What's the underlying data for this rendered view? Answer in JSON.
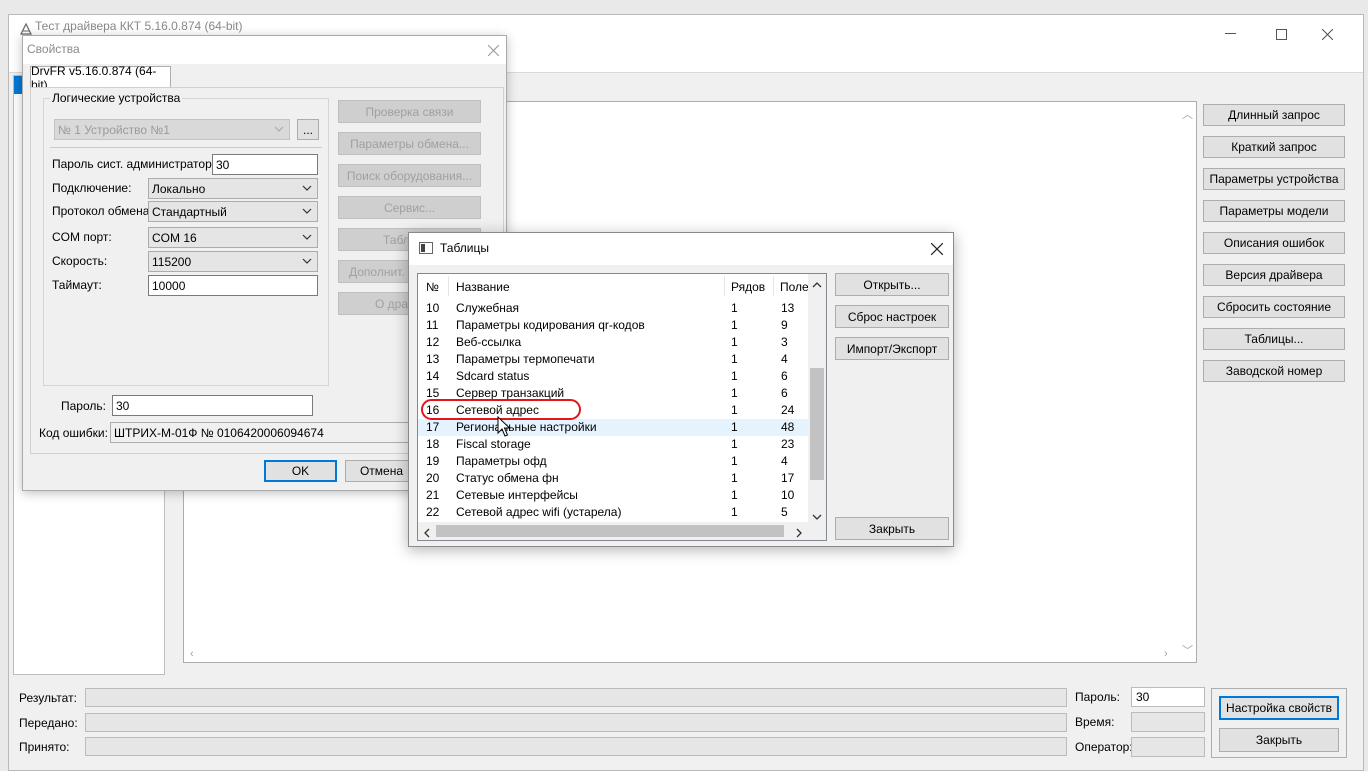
{
  "main_window": {
    "title": "Тест драйвера ККТ 5.16.0.874 (64-bit)",
    "controls": {
      "minimize": "—",
      "maximize": "☐",
      "close": "✕"
    },
    "right_buttons": [
      "Длинный запрос",
      "Краткий запрос",
      "Параметры устройства",
      "Параметры модели",
      "Описания ошибок",
      "Версия драйвера",
      "Сбросить состояние",
      "Таблицы...",
      "Заводской номер"
    ],
    "status": {
      "result_label": "Результат:",
      "sent_label": "Передано:",
      "received_label": "Принято:",
      "password_label": "Пароль:",
      "password_value": "30",
      "time_label": "Время:",
      "operator_label": "Оператор:"
    },
    "settings_button": "Настройка свойств",
    "close_button": "Закрыть"
  },
  "properties": {
    "title": "Свойства",
    "tab": "DrvFR v5.16.0.874 (64-bit)",
    "logical_devices_label": "Логические устройства",
    "logical_device_value": "№ 1 Устройство №1",
    "browse_button": "...",
    "admin_password_label": "Пароль сист. администратора:",
    "admin_password_value": "30",
    "connection_label": "Подключение:",
    "connection_value": "Локально",
    "protocol_label": "Протокол обмена:",
    "protocol_value": "Стандартный",
    "com_label": "COM порт:",
    "com_value": "COM 16",
    "speed_label": "Скорость:",
    "speed_value": "115200",
    "timeout_label": "Таймаут:",
    "timeout_value": "10000",
    "password_label": "Пароль:",
    "password_value": "30",
    "error_label": "Код ошибки:",
    "error_value": "ШТРИХ-М-01Ф № 0106420006094674",
    "side_buttons": [
      "Проверка связи",
      "Параметры обмена...",
      "Поиск оборудования...",
      "Сервис...",
      "Таблицы",
      "Дополнит. па",
      "О драйв"
    ],
    "ok_button": "OK",
    "cancel_button": "Отмена"
  },
  "tables": {
    "title": "Таблицы",
    "columns": {
      "num": "№",
      "name": "Название",
      "rows": "Рядов",
      "fields": "Поле"
    },
    "rows": [
      {
        "num": "10",
        "name": "Служебная",
        "rows": "1",
        "fields": "13"
      },
      {
        "num": "11",
        "name": "Параметры кодирования qr-кодов",
        "rows": "1",
        "fields": "9"
      },
      {
        "num": "12",
        "name": "Веб-ссылка",
        "rows": "1",
        "fields": "3"
      },
      {
        "num": "13",
        "name": "Параметры термопечати",
        "rows": "1",
        "fields": "4"
      },
      {
        "num": "14",
        "name": "Sdcard status",
        "rows": "1",
        "fields": "6"
      },
      {
        "num": "15",
        "name": "Сервер транзакций",
        "rows": "1",
        "fields": "6"
      },
      {
        "num": "16",
        "name": "Сетевой адрес",
        "rows": "1",
        "fields": "24"
      },
      {
        "num": "17",
        "name": "Региональные настройки",
        "rows": "1",
        "fields": "48"
      },
      {
        "num": "18",
        "name": "Fiscal storage",
        "rows": "1",
        "fields": "23"
      },
      {
        "num": "19",
        "name": "Параметры офд",
        "rows": "1",
        "fields": "4"
      },
      {
        "num": "20",
        "name": "Статус обмена фн",
        "rows": "1",
        "fields": "17"
      },
      {
        "num": "21",
        "name": "Сетевые интерфейсы",
        "rows": "1",
        "fields": "10"
      },
      {
        "num": "22",
        "name": "Сетевой адрес wifi (устарела)",
        "rows": "1",
        "fields": "5"
      }
    ],
    "buttons": {
      "open": "Открыть...",
      "reset": "Сброс настроек",
      "import_export": "Импорт/Экспорт",
      "close": "Закрыть"
    }
  },
  "colors": {
    "accent": "#0078d7",
    "highlight_oval": "#e0161b",
    "row_hover": "#e5f3ff"
  },
  "icons": [
    "app-icon",
    "minimize-icon",
    "maximize-icon",
    "close-icon",
    "chevron-down-icon",
    "scroll-up-icon",
    "scroll-down-icon",
    "scroll-left-icon",
    "scroll-right-icon",
    "table-window-icon",
    "mouse-cursor-icon"
  ]
}
